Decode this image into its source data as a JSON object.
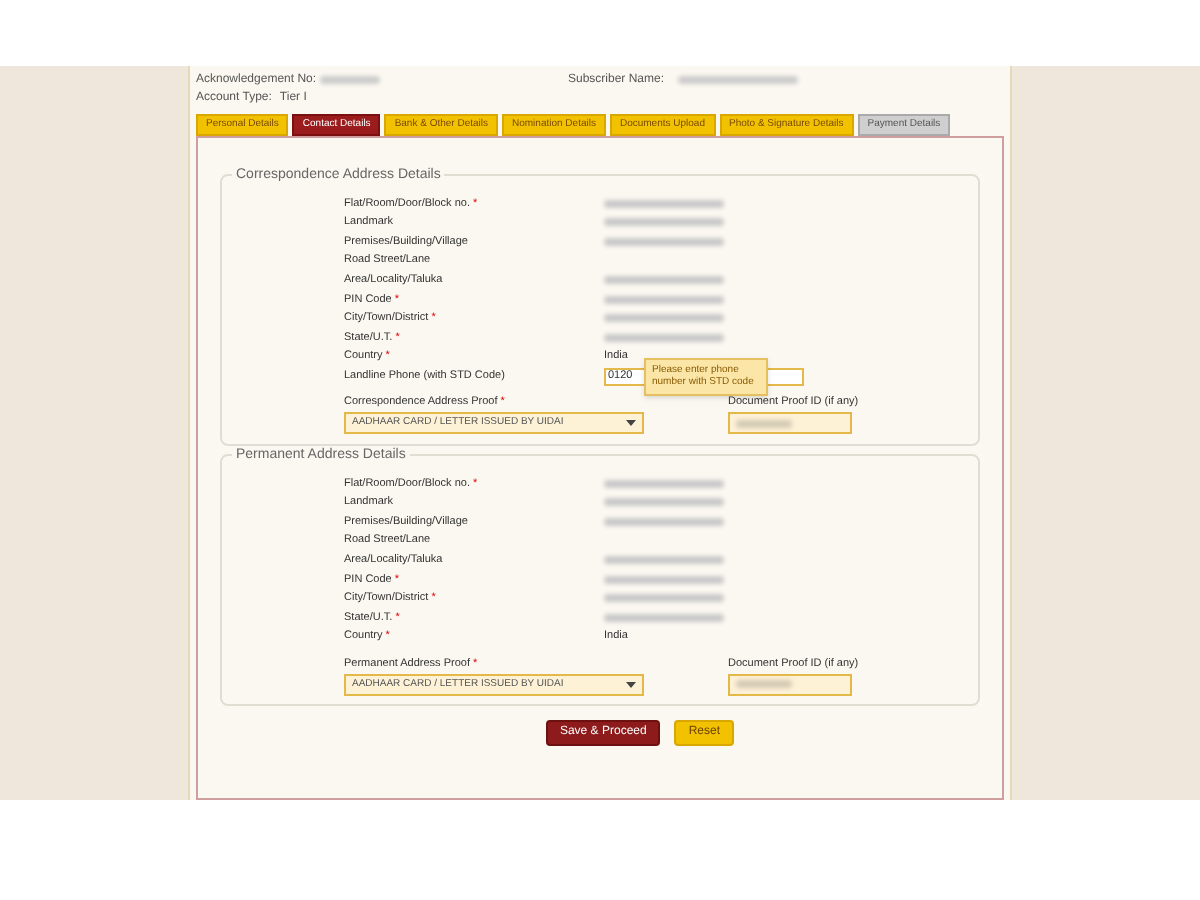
{
  "header": {
    "acknowledgement_label": "Acknowledgement No:",
    "subscriber_label": "Subscriber Name:",
    "account_type_label": "Account Type:",
    "account_type_value": "Tier I"
  },
  "tabs": [
    {
      "label": "Personal Details",
      "selected": false,
      "disabled": false
    },
    {
      "label": "Contact Details",
      "selected": true,
      "disabled": false
    },
    {
      "label": "Bank & Other Details",
      "selected": false,
      "disabled": false
    },
    {
      "label": "Nomination Details",
      "selected": false,
      "disabled": false
    },
    {
      "label": "Documents Upload",
      "selected": false,
      "disabled": false
    },
    {
      "label": "Photo & Signature Details",
      "selected": false,
      "disabled": false
    },
    {
      "label": "Payment Details",
      "selected": false,
      "disabled": true
    }
  ],
  "sections": [
    {
      "title": "Correspondence Address Details",
      "rows": [
        {
          "label": "Flat/Room/Door/Block no.",
          "mark": "*",
          "kind": "redacted"
        },
        {
          "label": "Landmark",
          "kind": "redacted"
        },
        {
          "label": "Premises/Building/Village",
          "kind": "redacted"
        },
        {
          "label": "Road Street/Lane",
          "kind": "empty"
        },
        {
          "label": "Area/Locality/Taluka",
          "kind": "redacted"
        },
        {
          "label": "PIN Code",
          "mark": "*",
          "kind": "redacted"
        },
        {
          "label": "City/Town/District",
          "mark": "*",
          "kind": "redacted"
        },
        {
          "label": "State/U.T.",
          "mark": "*",
          "kind": "redacted"
        },
        {
          "label": "Country",
          "mark": "*",
          "kind": "text",
          "value": "India"
        },
        {
          "label": "Landline Phone (with STD Code)",
          "kind": "phone",
          "value": "0120",
          "tooltip": "Please enter phone number with STD code"
        }
      ],
      "proof": {
        "label": "Correspondence Address Proof",
        "mark": "*",
        "value": "AADHAAR CARD / LETTER ISSUED BY UIDAI"
      },
      "doc_id_label": "Document Proof ID (if any)"
    },
    {
      "title": "Permanent Address Details",
      "rows": [
        {
          "label": "Flat/Room/Door/Block no.",
          "mark": "*",
          "kind": "redacted"
        },
        {
          "label": "Landmark",
          "kind": "redacted"
        },
        {
          "label": "Premises/Building/Village",
          "kind": "redacted"
        },
        {
          "label": "Road Street/Lane",
          "kind": "empty"
        },
        {
          "label": "Area/Locality/Taluka",
          "kind": "redacted"
        },
        {
          "label": "PIN Code",
          "mark": "*",
          "kind": "redacted"
        },
        {
          "label": "City/Town/District",
          "mark": "*",
          "kind": "redacted"
        },
        {
          "label": "State/U.T.",
          "mark": "*",
          "kind": "redacted"
        },
        {
          "label": "Country",
          "mark": "*",
          "kind": "text",
          "value": "India"
        }
      ],
      "proof": {
        "label": "Permanent Address Proof",
        "mark": "*",
        "value": "AADHAAR CARD / LETTER ISSUED BY UIDAI"
      },
      "doc_id_label": "Document Proof ID (if any)"
    }
  ],
  "buttons": [
    {
      "label": "Save & Proceed",
      "kind": "primary"
    },
    {
      "label": "Reset",
      "kind": "secondary"
    }
  ]
}
